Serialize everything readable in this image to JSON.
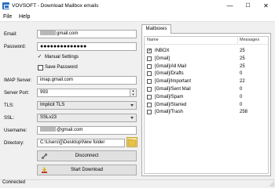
{
  "window": {
    "title": "VOVSOFT - Download Mailbox emails",
    "minimize": "—",
    "maximize": "☐",
    "close": "✕"
  },
  "menu": {
    "file": "File",
    "help": "Help"
  },
  "form": {
    "email_label": "Email:",
    "email_value": "gmail.com",
    "password_label": "Password:",
    "password_value": "●●●●●●●●●●●●●●",
    "manual_settings_label": "Manual Settings",
    "save_password_label": "Save Password",
    "imap_server_label": "IMAP Server:",
    "imap_server_value": "imap.gmail.com",
    "server_port_label": "Server Port:",
    "server_port_value": "993",
    "tls_label": "TLS:",
    "tls_value": "Implicit TLS",
    "ssl_label": "SSL:",
    "ssl_value": "SSLv23",
    "username_label": "Username:",
    "username_value": "@gmail.com",
    "directory_label": "Directory:",
    "directory_value": "C:\\Users\\[]\\Desktop\\New folder"
  },
  "buttons": {
    "disconnect": "Disconnect",
    "start_download": "Start Download"
  },
  "mailboxes": {
    "tab_label": "Mailboxes",
    "col_name": "Name",
    "col_messages": "Messages",
    "rows": [
      {
        "name": "INBOX",
        "count": "25",
        "checked": "✓"
      },
      {
        "name": "[Gmail]",
        "count": "25",
        "checked": ""
      },
      {
        "name": "[Gmail]/All Mail",
        "count": "25",
        "checked": ""
      },
      {
        "name": "[Gmail]/Drafts",
        "count": "0",
        "checked": ""
      },
      {
        "name": "[Gmail]/Important",
        "count": "22",
        "checked": ""
      },
      {
        "name": "[Gmail]/Sent Mail",
        "count": "0",
        "checked": ""
      },
      {
        "name": "[Gmail]/Spam",
        "count": "0",
        "checked": ""
      },
      {
        "name": "[Gmail]/Starred",
        "count": "0",
        "checked": ""
      },
      {
        "name": "[Gmail]/Trash",
        "count": "258",
        "checked": ""
      }
    ]
  },
  "status": {
    "text": "Connected"
  },
  "icons": {
    "app": "app-icon",
    "checkmark": "checkmark-icon",
    "folder": "folder-icon",
    "disconnect": "disconnect-icon",
    "download": "download-icon",
    "resize_grip": "resize-grip-icon"
  },
  "colors": {
    "accent": "#2a6fbf",
    "folder": "#f6e59a"
  }
}
